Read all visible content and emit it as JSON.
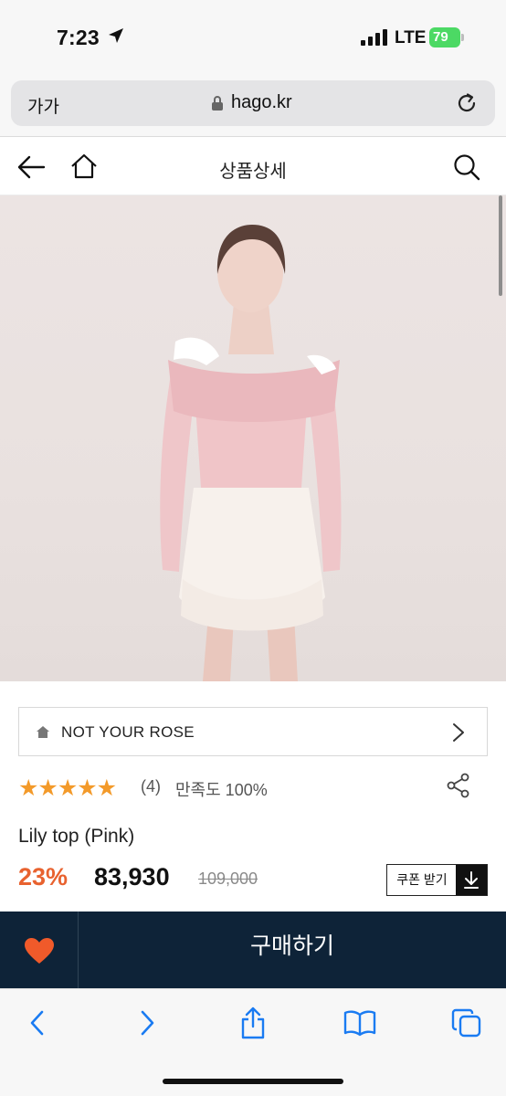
{
  "status_bar": {
    "time": "7:23",
    "network": "LTE",
    "battery": "79"
  },
  "browser": {
    "text_size_label": "가가",
    "domain": "hago.kr"
  },
  "header": {
    "title": "상품상세"
  },
  "brand": {
    "name": "NOT YOUR ROSE"
  },
  "rating": {
    "stars": 5,
    "stars_text": "★★★★★",
    "count": "(4)",
    "satisfaction": "만족도 100%"
  },
  "product": {
    "name": "Lily top (Pink)",
    "discount": "23%",
    "price": "83,930",
    "original_price": "109,000"
  },
  "coupon": {
    "label": "쿠폰 받기"
  },
  "buy": {
    "label": "구매하기"
  },
  "colors": {
    "accent": "#e8622f",
    "star": "#f39a2a",
    "buy_bar": "#0e2338",
    "safari_blue": "#1a7bf2"
  }
}
